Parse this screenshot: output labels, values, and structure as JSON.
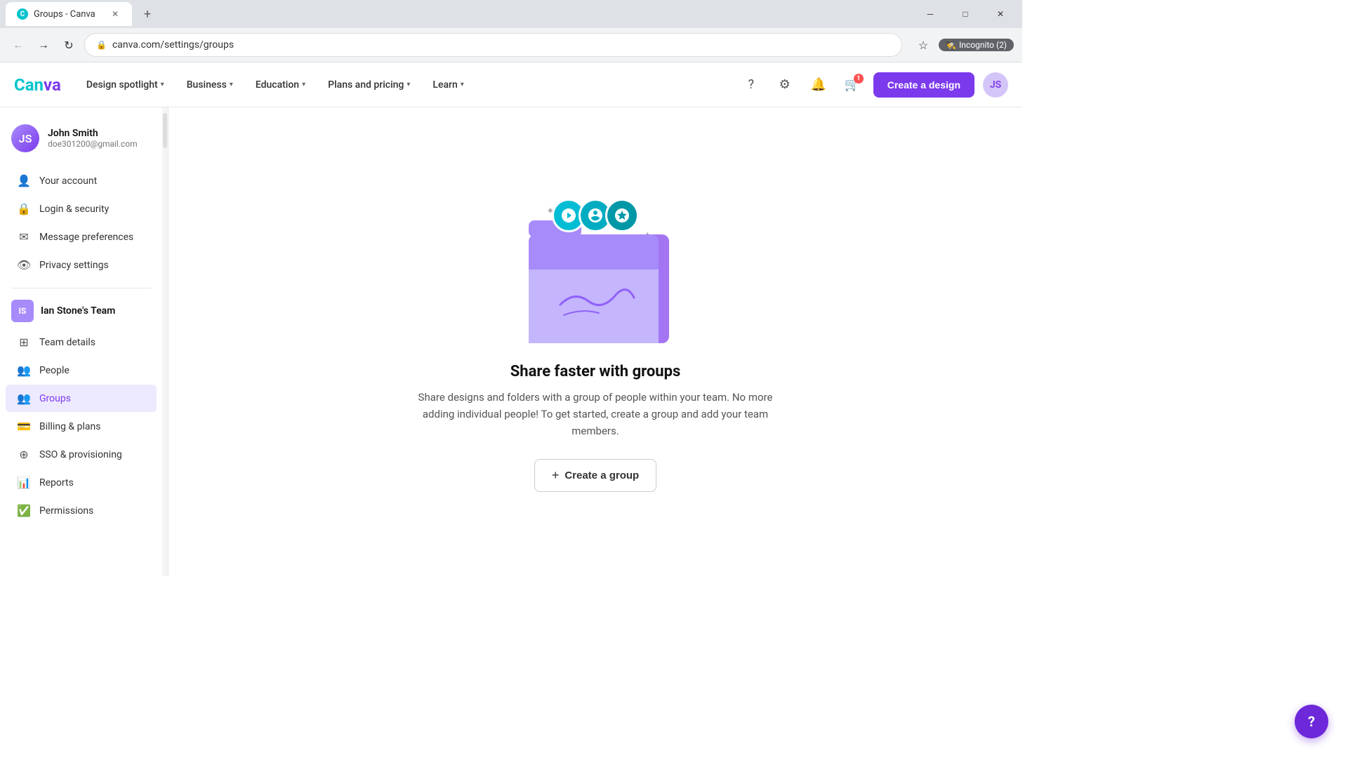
{
  "browser": {
    "tab_title": "Groups - Canva",
    "tab_favicon": "C",
    "url": "canva.com/settings/groups",
    "incognito_label": "Incognito (2)"
  },
  "nav": {
    "logo": "Canva",
    "items": [
      {
        "label": "Design spotlight",
        "has_chevron": true
      },
      {
        "label": "Business",
        "has_chevron": true
      },
      {
        "label": "Education",
        "has_chevron": true
      },
      {
        "label": "Plans and pricing",
        "has_chevron": true
      },
      {
        "label": "Learn",
        "has_chevron": true
      }
    ],
    "create_design_label": "Create a design",
    "cart_count": "1"
  },
  "sidebar": {
    "user": {
      "name": "John Smith",
      "email": "doe301200@gmail.com",
      "initials": "JS"
    },
    "personal_items": [
      {
        "id": "your-account",
        "label": "Your account",
        "icon": "person"
      },
      {
        "id": "login-security",
        "label": "Login & security",
        "icon": "lock"
      },
      {
        "id": "message-preferences",
        "label": "Message preferences",
        "icon": "mail"
      },
      {
        "id": "privacy-settings",
        "label": "Privacy settings",
        "icon": "eye"
      }
    ],
    "team": {
      "name": "Ian Stone's Team",
      "initials": "IS"
    },
    "team_items": [
      {
        "id": "team-details",
        "label": "Team details",
        "icon": "grid"
      },
      {
        "id": "people",
        "label": "People",
        "icon": "people"
      },
      {
        "id": "groups",
        "label": "Groups",
        "icon": "groups",
        "active": true
      },
      {
        "id": "billing-plans",
        "label": "Billing & plans",
        "icon": "card"
      },
      {
        "id": "sso-provisioning",
        "label": "SSO & provisioning",
        "icon": "sso"
      },
      {
        "id": "reports",
        "label": "Reports",
        "icon": "report"
      },
      {
        "id": "permissions",
        "label": "Permissions",
        "icon": "check-circle"
      }
    ]
  },
  "main": {
    "heading": "Share faster with groups",
    "subtext": "Share designs and folders with a group of people within your team. No more adding individual people! To get started, create a group and add your team members.",
    "create_group_label": "Create a group"
  },
  "help_button": "?"
}
